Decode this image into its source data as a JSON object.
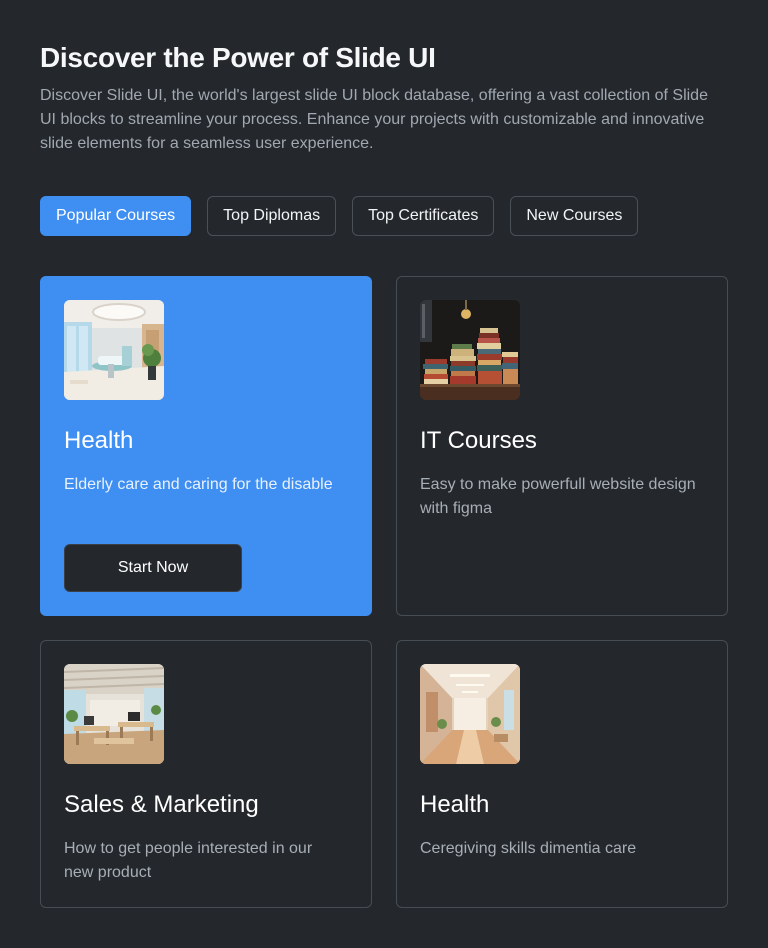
{
  "header": {
    "title": "Discover the Power of Slide UI",
    "description": "Discover Slide UI, the world's largest slide UI block database, offering a vast collection of Slide UI blocks to streamline your process. Enhance your projects with customizable and innovative slide elements for a seamless user experience."
  },
  "tabs": [
    {
      "label": "Popular Courses",
      "active": true
    },
    {
      "label": "Top Diplomas",
      "active": false
    },
    {
      "label": "Top Certificates",
      "active": false
    },
    {
      "label": "New Courses",
      "active": false
    }
  ],
  "cards": [
    {
      "title": "Health",
      "description": "Elderly care and caring for the disable",
      "image": "clinic-interior-image",
      "button_label": "Start Now",
      "featured": true
    },
    {
      "title": "IT Courses",
      "description": "Easy to make powerfull website design with figma",
      "image": "book-stacks-image",
      "featured": false
    },
    {
      "title": "Sales & Marketing",
      "description": "How to get people interested in our new product",
      "image": "office-interior-image",
      "featured": false
    },
    {
      "title": "Health",
      "description": "Ceregiving skills dimentia care",
      "image": "hallway-interior-image",
      "featured": false
    }
  ],
  "colors": {
    "background": "#24282d",
    "accent": "#3f8ff2",
    "border": "#474d55",
    "muted_text": "#a1a8b1"
  }
}
